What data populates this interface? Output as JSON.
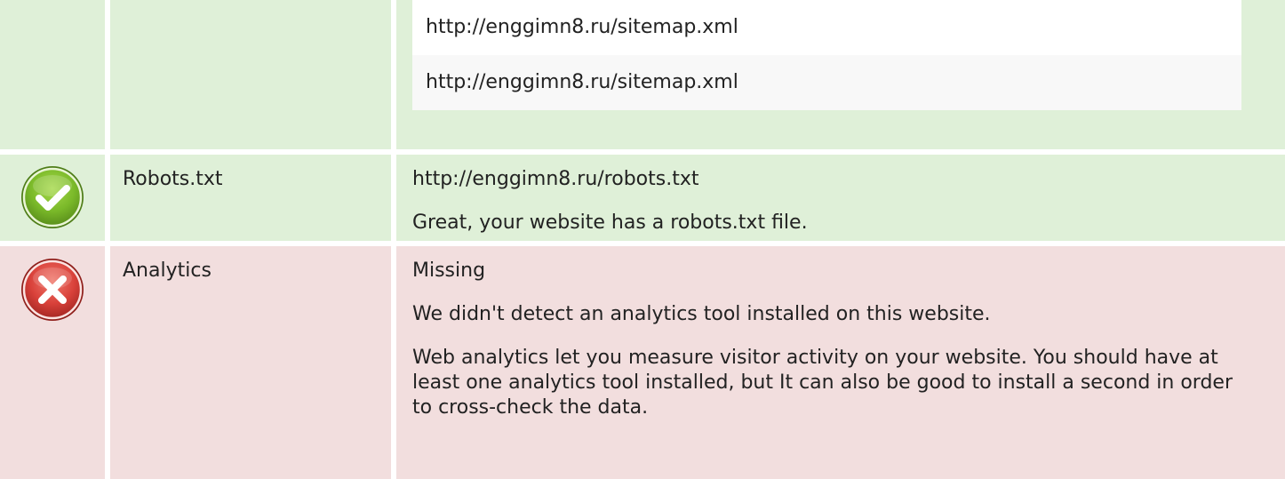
{
  "sitemap": {
    "urls": [
      "http://enggimn8.ru/sitemap.xml",
      "http://enggimn8.ru/sitemap.xml"
    ]
  },
  "robots": {
    "status": "pass",
    "icon": "check-circle-icon",
    "name": "Robots.txt",
    "value": "http://enggimn8.ru/robots.txt",
    "message": "Great, your website has a robots.txt file."
  },
  "analytics": {
    "status": "fail",
    "icon": "x-circle-icon",
    "name": "Analytics",
    "value": "Missing",
    "message": "We didn't detect an analytics tool installed on this website.",
    "detail": "Web analytics let you measure visitor activity on your website. You should have at least one analytics tool installed, but It can also be good to install a second in order to cross-check the data."
  },
  "colors": {
    "pass_bg": "#dff0d8",
    "fail_bg": "#f2dede",
    "pass_icon": "#7ab929",
    "fail_icon": "#d9413a"
  }
}
